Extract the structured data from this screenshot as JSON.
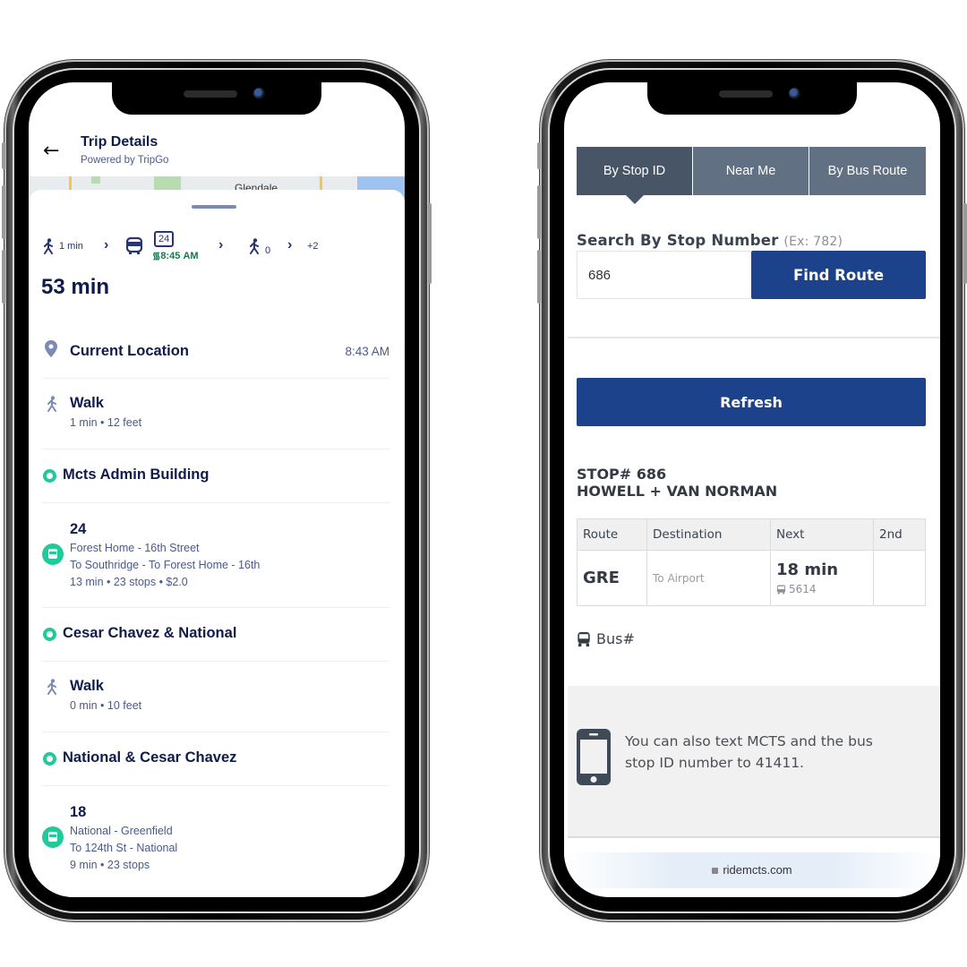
{
  "left_phone": {
    "header": {
      "back_icon": "arrow-left-icon",
      "title": "Trip Details",
      "subtitle": "Powered by TripGo"
    },
    "map": {
      "label": "Glendale"
    },
    "summary": {
      "walk1": "1 min",
      "route_badge": "24",
      "realtime": "8:45 AM",
      "walk2": "0",
      "more": "+2",
      "chevron": "›"
    },
    "duration": "53 min",
    "segments": [
      {
        "type": "origin",
        "title": "Current Location",
        "time": "8:43 AM",
        "icon": "location-pin-icon"
      },
      {
        "type": "walk",
        "title": "Walk",
        "detail": "1 min • 12 feet",
        "icon": "walk-icon"
      },
      {
        "type": "stop",
        "title": "Mcts Admin Building",
        "icon": "stop-circle-icon"
      },
      {
        "type": "bus",
        "title": "24",
        "lines": [
          "Forest Home - 16th Street",
          "To Southridge - To Forest Home - 16th",
          "13 min • 23 stops • $2.0"
        ],
        "icon": "bus-icon"
      },
      {
        "type": "stop",
        "title": "Cesar Chavez & National",
        "icon": "stop-circle-icon"
      },
      {
        "type": "walk",
        "title": "Walk",
        "detail": "0 min • 10 feet",
        "icon": "walk-icon"
      },
      {
        "type": "stop",
        "title": "National & Cesar Chavez",
        "icon": "stop-circle-icon"
      },
      {
        "type": "bus",
        "title": "18",
        "lines": [
          "National - Greenfield",
          "To 124th St - National",
          "9 min • 23 stops"
        ],
        "icon": "bus-icon"
      }
    ],
    "colors": {
      "navy": "#0f1b4a",
      "accent_green": "#22c99a",
      "realtime_green": "#147a4a",
      "muted": "#4a5a8c"
    }
  },
  "right_phone": {
    "tabs": [
      {
        "label": "By Stop ID",
        "active": true
      },
      {
        "label": "Near Me",
        "active": false
      },
      {
        "label": "By Bus Route",
        "active": false
      }
    ],
    "search": {
      "label": "Search By Stop Number",
      "hint": "(Ex: 782)",
      "value": "686",
      "button": "Find Route"
    },
    "refresh_button": "Refresh",
    "stop": {
      "number_line": "STOP# 686",
      "name": "HOWELL + VAN NORMAN"
    },
    "table": {
      "headers": [
        "Route",
        "Destination",
        "Next",
        "2nd"
      ],
      "rows": [
        {
          "route": "GRE",
          "destination": "To Airport",
          "next": "18 min",
          "bus_number": "5614",
          "second": ""
        }
      ]
    },
    "bus_legend": "Bus#",
    "text_info": "You can also text MCTS and the bus stop ID number to 41411.",
    "url": "ridemcts.com",
    "colors": {
      "primary_blue": "#1b428a",
      "tab_active": "#485566",
      "tab_inactive": "#627083"
    }
  }
}
